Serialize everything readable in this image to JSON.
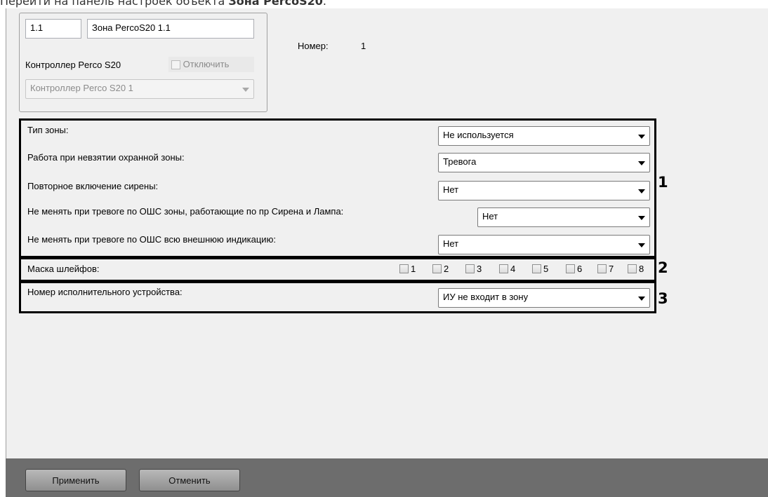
{
  "caption": {
    "prefix": "Перейти на панель настроек объекта ",
    "bold": "Зона PercoS20",
    "suffix": "."
  },
  "object": {
    "id": "1.1",
    "name": "Зона PercoS20 1.1",
    "parent_label": "Контроллер Perco S20",
    "disable_label": "Отключить",
    "parent_value": "Контроллер Perco S20 1",
    "number_label": "Номер:",
    "number_value": "1"
  },
  "section1": {
    "callout": "1",
    "rows": [
      {
        "label": "Тип зоны:",
        "value": "Не используется"
      },
      {
        "label": "Работа при невзятии охранной зоны:",
        "value": "Тревога"
      },
      {
        "label": "Повторное включение сирены:",
        "value": "Нет"
      },
      {
        "label": "Не менять при тревоге по ОШС зоны, работающие по пр Сирена и Лампа:",
        "value": "Нет"
      },
      {
        "label": "Не менять при тревоге по ОШС всю внешнюю индикацию:",
        "value": "Нет"
      }
    ]
  },
  "section2": {
    "callout": "2",
    "label": "Маска шлейфов:",
    "items": [
      "1",
      "2",
      "3",
      "4",
      "5",
      "6",
      "7",
      "8"
    ]
  },
  "section3": {
    "callout": "3",
    "label": "Номер исполнительного устройства:",
    "value": "ИУ не входит в зону"
  },
  "buttons": {
    "apply": "Применить",
    "cancel": "Отменить"
  }
}
